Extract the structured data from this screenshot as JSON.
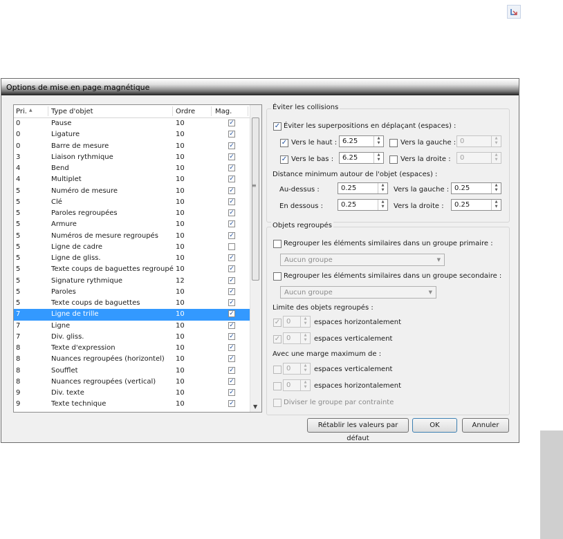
{
  "window_title": "Options de mise en page magnétique",
  "list": {
    "headers": {
      "pri": "Pri.",
      "type": "Type d'objet",
      "ordre": "Ordre",
      "mag": "Mag."
    },
    "rows": [
      {
        "pri": "0",
        "type": "Pause",
        "ordre": "10",
        "mag": true
      },
      {
        "pri": "0",
        "type": "Ligature",
        "ordre": "10",
        "mag": true
      },
      {
        "pri": "0",
        "type": "Barre de mesure",
        "ordre": "10",
        "mag": true
      },
      {
        "pri": "3",
        "type": "Liaison rythmique",
        "ordre": "10",
        "mag": true
      },
      {
        "pri": "4",
        "type": "Bend",
        "ordre": "10",
        "mag": true
      },
      {
        "pri": "4",
        "type": "Multiplet",
        "ordre": "10",
        "mag": true
      },
      {
        "pri": "5",
        "type": "Numéro de mesure",
        "ordre": "10",
        "mag": true
      },
      {
        "pri": "5",
        "type": "Clé",
        "ordre": "10",
        "mag": true
      },
      {
        "pri": "5",
        "type": "Paroles regroupées",
        "ordre": "10",
        "mag": true
      },
      {
        "pri": "5",
        "type": "Armure",
        "ordre": "10",
        "mag": true
      },
      {
        "pri": "5",
        "type": "Numéros de mesure regroupés",
        "ordre": "10",
        "mag": true
      },
      {
        "pri": "5",
        "type": "Ligne de cadre",
        "ordre": "10",
        "mag": false
      },
      {
        "pri": "5",
        "type": "Ligne de gliss.",
        "ordre": "10",
        "mag": true
      },
      {
        "pri": "5",
        "type": "Texte coups de baguettes regroupé",
        "ordre": "10",
        "mag": true
      },
      {
        "pri": "5",
        "type": "Signature rythmique",
        "ordre": "12",
        "mag": true
      },
      {
        "pri": "5",
        "type": "Paroles",
        "ordre": "10",
        "mag": true
      },
      {
        "pri": "5",
        "type": "Texte coups de baguettes",
        "ordre": "10",
        "mag": true
      },
      {
        "pri": "7",
        "type": "Ligne de trille",
        "ordre": "10",
        "mag": true,
        "selected": true
      },
      {
        "pri": "7",
        "type": "Ligne",
        "ordre": "10",
        "mag": true
      },
      {
        "pri": "7",
        "type": "Div. gliss.",
        "ordre": "10",
        "mag": true
      },
      {
        "pri": "8",
        "type": "Texte d'expression",
        "ordre": "10",
        "mag": true
      },
      {
        "pri": "8",
        "type": "Nuances regroupées (horizontel)",
        "ordre": "10",
        "mag": true
      },
      {
        "pri": "8",
        "type": "Soufflet",
        "ordre": "10",
        "mag": true
      },
      {
        "pri": "8",
        "type": "Nuances regroupées (vertical)",
        "ordre": "10",
        "mag": true
      },
      {
        "pri": "9",
        "type": "Div. texte",
        "ordre": "10",
        "mag": true
      },
      {
        "pri": "9",
        "type": "Texte technique",
        "ordre": "10",
        "mag": true
      }
    ]
  },
  "collisions": {
    "legend": "Éviter les collisions",
    "avoid_label": "Éviter les superpositions en déplaçant (espaces) :",
    "avoid_checked": true,
    "up_label": "Vers le haut :",
    "up_value": "6.25",
    "up_checked": true,
    "down_label": "Vers le bas :",
    "down_value": "6.25",
    "down_checked": true,
    "left_label": "Vers la gauche :",
    "left_value": "0",
    "left_checked": false,
    "right_label": "Vers la droite :",
    "right_value": "0",
    "right_checked": false,
    "distance_label": "Distance minimum autour de l'objet (espaces) :",
    "above_label": "Au-dessus :",
    "above_value": "0.25",
    "below_label": "En dessous :",
    "below_value": "0.25",
    "dist_left_label": "Vers la gauche :",
    "dist_left_value": "0.25",
    "dist_right_label": "Vers la droite :",
    "dist_right_value": "0.25"
  },
  "grouped": {
    "legend": "Objets regroupés",
    "primary_label": "Regrouper les éléments similaires dans un groupe primaire :",
    "primary_select": "Aucun groupe",
    "secondary_label": "Regrouper les éléments similaires dans un groupe secondaire :",
    "secondary_select": "Aucun groupe",
    "limit_label": "Limite des objets regroupés :",
    "limit_h_value": "0",
    "limit_h_label": "espaces horizontalement",
    "limit_v_value": "0",
    "limit_v_label": "espaces verticalement",
    "margin_label": "Avec une marge maximum de :",
    "margin_v_value": "0",
    "margin_v_label": "espaces verticalement",
    "margin_h_value": "0",
    "margin_h_label": "espaces horizontalement",
    "split_label": "Diviser le groupe par contrainte"
  },
  "buttons": {
    "reset": "Rétablir les valeurs par défaut",
    "ok": "OK",
    "cancel": "Annuler"
  }
}
